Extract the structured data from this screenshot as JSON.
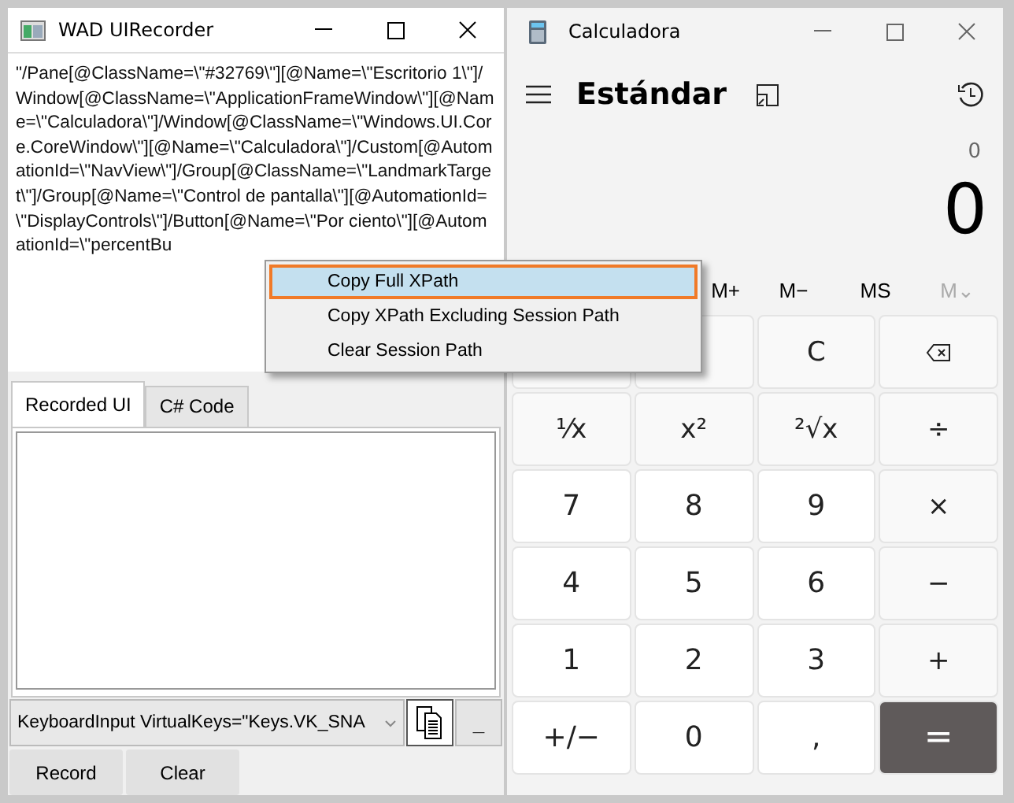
{
  "recorder": {
    "title": "WAD UIRecorder",
    "xpath": "\"/Pane[@ClassName=\\\"#32769\\\"][@Name=\\\"Escritorio 1\\\"]/Window[@ClassName=\\\"ApplicationFrameWindow\\\"][@Name=\\\"Calculadora\\\"]/Window[@ClassName=\\\"Windows.UI.Core.CoreWindow\\\"][@Name=\\\"Calculadora\\\"]/Custom[@AutomationId=\\\"NavView\\\"]/Group[@ClassName=\\\"LandmarkTarget\\\"]/Group[@Name=\\\"Control de pantalla\\\"][@AutomationId=\\\"DisplayControls\\\"]/Button[@Name=\\\"Por ciento\\\"][@AutomationId=\\\"percentBu",
    "tabs": [
      {
        "label": "Recorded UI",
        "selected": true
      },
      {
        "label": "C# Code",
        "selected": false
      }
    ],
    "combo": {
      "value": "KeyboardInput VirtualKeys=\"Keys.VK_SNA"
    },
    "minus_button": "_",
    "buttons": [
      "Record",
      "Clear"
    ]
  },
  "context_menu": [
    {
      "label": "Copy Full XPath",
      "selected": true
    },
    {
      "label": "Copy XPath Excluding Session Path",
      "selected": false
    },
    {
      "label": "Clear Session Path",
      "selected": false
    }
  ],
  "calculator": {
    "title": "Calculadora",
    "mode": "Estándar",
    "expression": "0",
    "display": "0",
    "memory": [
      {
        "label": "M+",
        "disabled": false
      },
      {
        "label": "M−",
        "disabled": false
      },
      {
        "label": "MS",
        "disabled": false
      },
      {
        "label": "M⌄",
        "disabled": true
      }
    ],
    "keys": [
      {
        "kind": "fn"
      },
      {
        "kind": "fn"
      },
      {
        "kind": "fn",
        "label": "C"
      },
      {
        "kind": "backspace"
      },
      {
        "kind": "fn",
        "label": "¹⁄x"
      },
      {
        "kind": "fn",
        "label": "x²"
      },
      {
        "kind": "fn",
        "label": "²√x"
      },
      {
        "kind": "fn",
        "label": "÷"
      },
      {
        "kind": "num",
        "label": "7"
      },
      {
        "kind": "num",
        "label": "8"
      },
      {
        "kind": "num",
        "label": "9"
      },
      {
        "kind": "fn",
        "label": "×"
      },
      {
        "kind": "num",
        "label": "4"
      },
      {
        "kind": "num",
        "label": "5"
      },
      {
        "kind": "num",
        "label": "6"
      },
      {
        "kind": "fn",
        "label": "−"
      },
      {
        "kind": "num",
        "label": "1"
      },
      {
        "kind": "num",
        "label": "2"
      },
      {
        "kind": "num",
        "label": "3"
      },
      {
        "kind": "fn",
        "label": "+"
      },
      {
        "kind": "num",
        "label": "+/−"
      },
      {
        "kind": "num",
        "label": "0"
      },
      {
        "kind": "num",
        "label": ","
      },
      {
        "kind": "equals",
        "label": "="
      }
    ]
  }
}
